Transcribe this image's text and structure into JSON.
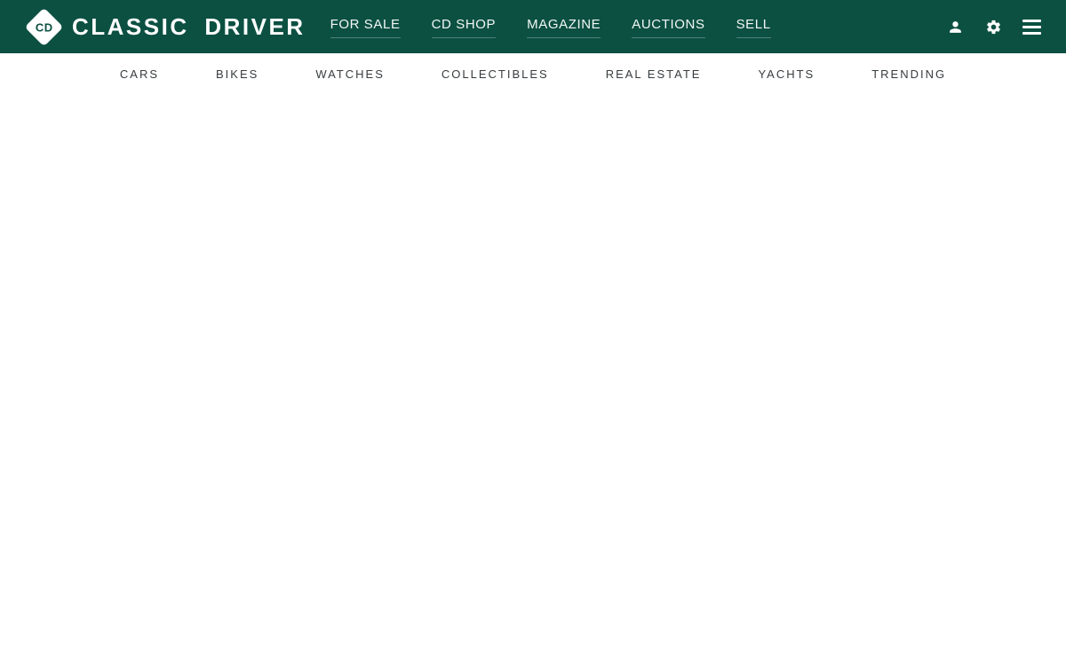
{
  "brand": {
    "abbrev": "CD",
    "name": "CLASSIC DRIVER"
  },
  "primary_nav": {
    "items": [
      {
        "label": "FOR SALE"
      },
      {
        "label": "CD SHOP"
      },
      {
        "label": "MAGAZINE"
      },
      {
        "label": "AUCTIONS"
      },
      {
        "label": "SELL"
      }
    ]
  },
  "header_actions": {
    "icons": [
      {
        "name": "user-icon",
        "shape": "person-silhouette"
      },
      {
        "name": "gear-icon",
        "shape": "cog"
      },
      {
        "name": "menu-icon",
        "shape": "hamburger-3-bars"
      }
    ]
  },
  "secondary_nav": {
    "items": [
      {
        "label": "CARS"
      },
      {
        "label": "BIKES"
      },
      {
        "label": "WATCHES"
      },
      {
        "label": "COLLECTIBLES"
      },
      {
        "label": "REAL ESTATE"
      },
      {
        "label": "YACHTS"
      },
      {
        "label": "TRENDING"
      }
    ]
  },
  "colors": {
    "header_bg": "#0c5042",
    "header_text": "#ffffff",
    "nav_underline": "rgba(255,255,255,0.28)",
    "secondary_text": "#383c3f",
    "page_bg": "#ffffff"
  }
}
